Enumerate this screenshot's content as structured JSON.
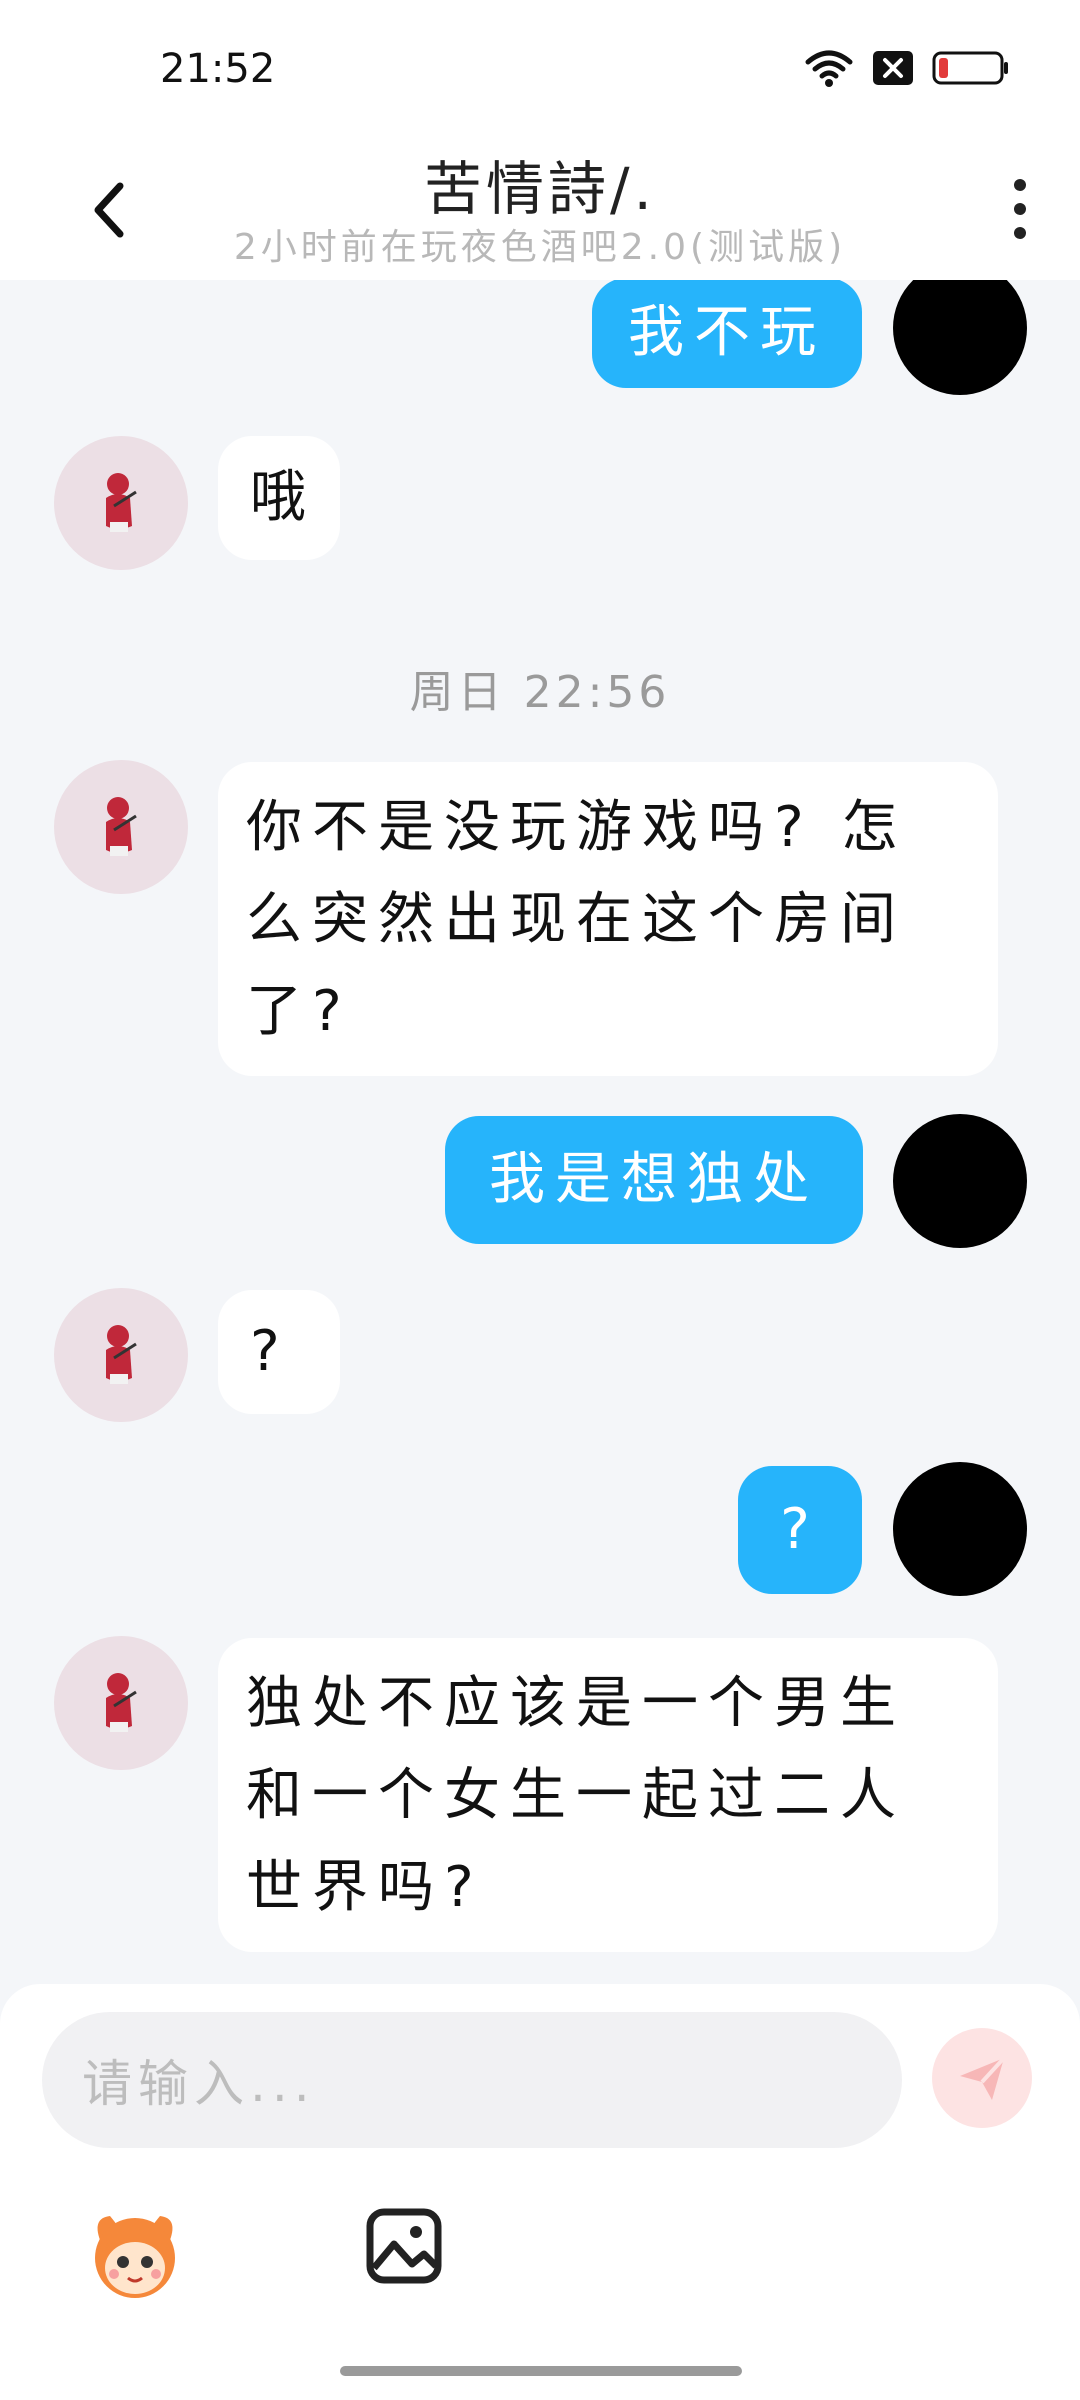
{
  "status_bar": {
    "time": "21:52"
  },
  "header": {
    "title": "苦情詩/.",
    "subtitle": "2小时前在玩夜色酒吧2.0(测试版)"
  },
  "messages": [
    {
      "sender": "me",
      "text": "我不玩"
    },
    {
      "sender": "them",
      "text": "哦"
    },
    {
      "type": "time",
      "text": "周日 22:56"
    },
    {
      "sender": "them",
      "text": "你不是没玩游戏吗? 怎么突然出现在这个房间了?"
    },
    {
      "sender": "me",
      "text": "我是想独处"
    },
    {
      "sender": "them",
      "text": "?"
    },
    {
      "sender": "me",
      "text": "?"
    },
    {
      "sender": "them",
      "text": "独处不应该是一个男生和一个女生一起过二人世界吗?"
    }
  ],
  "composer": {
    "placeholder": "请输入..."
  },
  "icons": {
    "back": "chevron-left-icon",
    "more": "more-vertical-icon",
    "send": "paper-plane-icon",
    "emoji": "mascot-emoji-icon",
    "image": "image-icon"
  },
  "colors": {
    "my_bubble": "#26b4fb",
    "their_bubble": "#ffffff",
    "background": "#f4f6f9"
  }
}
